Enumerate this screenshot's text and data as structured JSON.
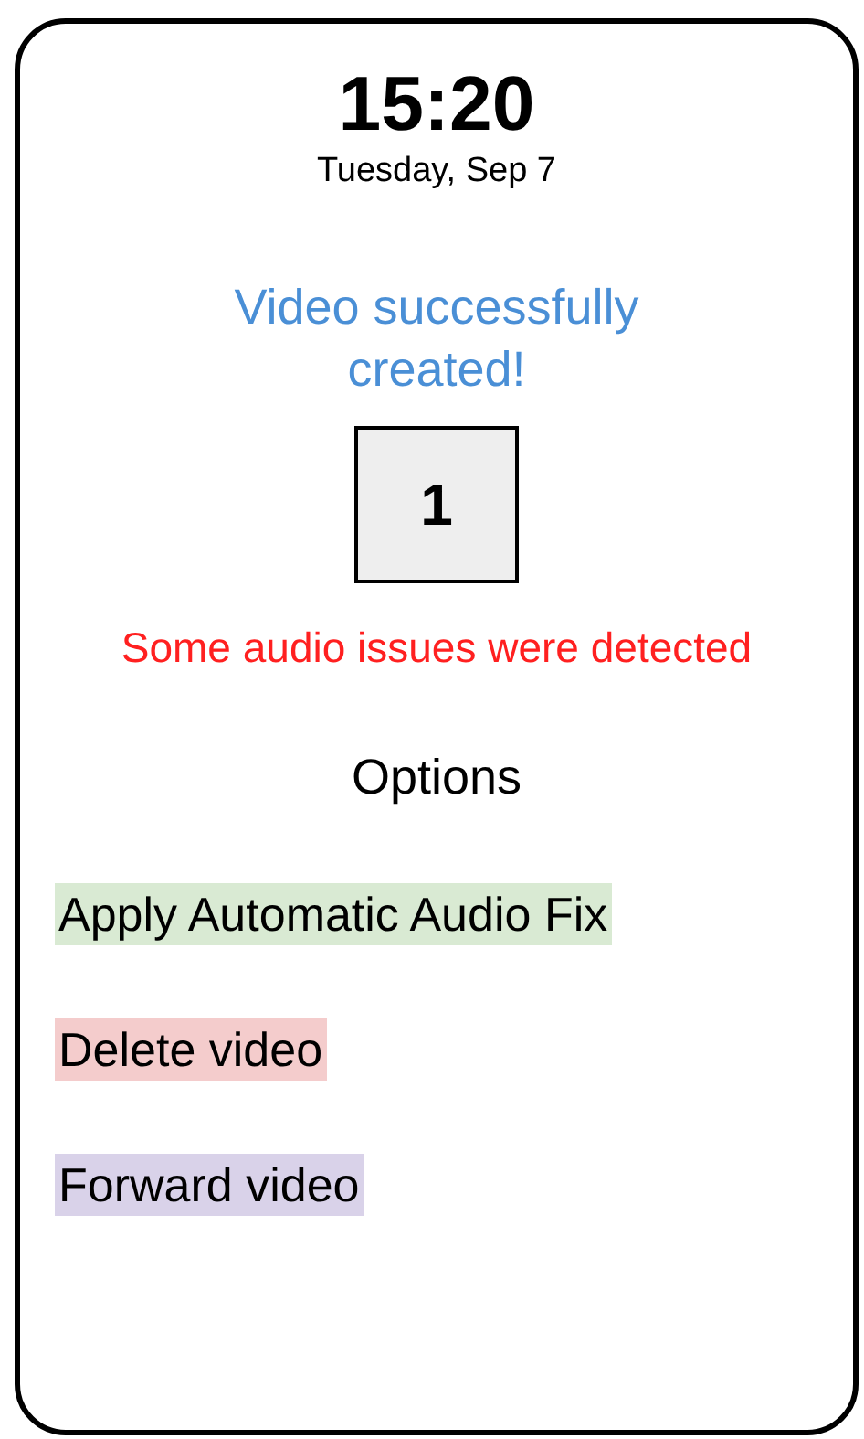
{
  "status": {
    "time": "15:20",
    "date": "Tuesday, Sep 7"
  },
  "message": "Video successfully created!",
  "video_count": "1",
  "warning": "Some audio issues were detected",
  "options_title": "Options",
  "options": [
    {
      "label": "Apply Automatic Audio Fix",
      "color": "#d9ead3"
    },
    {
      "label": "Delete video",
      "color": "#f4cccc"
    },
    {
      "label": "Forward video",
      "color": "#d9d2e9"
    }
  ]
}
